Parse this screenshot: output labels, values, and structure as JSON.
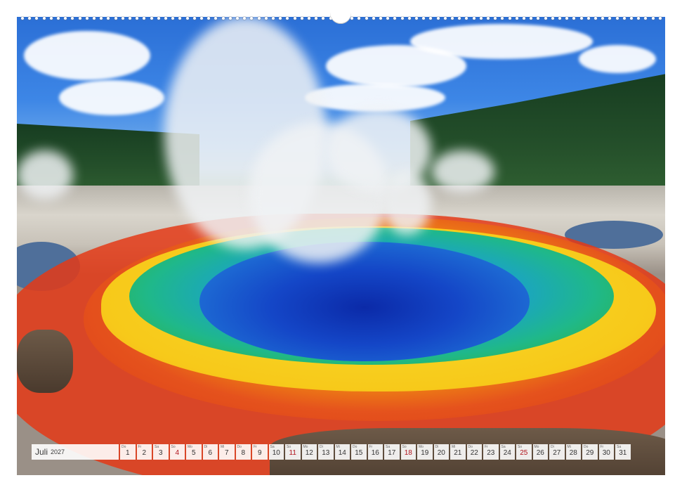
{
  "calendar": {
    "month": "Juli",
    "year": "2027",
    "days": [
      {
        "dow": "Do",
        "num": "1"
      },
      {
        "dow": "Fr",
        "num": "2"
      },
      {
        "dow": "Sa",
        "num": "3"
      },
      {
        "dow": "So",
        "num": "4",
        "sun": true
      },
      {
        "dow": "Mo",
        "num": "5"
      },
      {
        "dow": "Di",
        "num": "6"
      },
      {
        "dow": "Mi",
        "num": "7"
      },
      {
        "dow": "Do",
        "num": "8"
      },
      {
        "dow": "Fr",
        "num": "9"
      },
      {
        "dow": "Sa",
        "num": "10"
      },
      {
        "dow": "So",
        "num": "11",
        "sun": true
      },
      {
        "dow": "Mo",
        "num": "12"
      },
      {
        "dow": "Di",
        "num": "13"
      },
      {
        "dow": "Mi",
        "num": "14"
      },
      {
        "dow": "Do",
        "num": "15"
      },
      {
        "dow": "Fr",
        "num": "16"
      },
      {
        "dow": "Sa",
        "num": "17"
      },
      {
        "dow": "So",
        "num": "18",
        "sun": true
      },
      {
        "dow": "Mo",
        "num": "19"
      },
      {
        "dow": "Di",
        "num": "20"
      },
      {
        "dow": "Mi",
        "num": "21"
      },
      {
        "dow": "Do",
        "num": "22"
      },
      {
        "dow": "Fr",
        "num": "23"
      },
      {
        "dow": "Sa",
        "num": "24"
      },
      {
        "dow": "So",
        "num": "25",
        "sun": true
      },
      {
        "dow": "Mo",
        "num": "26"
      },
      {
        "dow": "Di",
        "num": "27"
      },
      {
        "dow": "Mi",
        "num": "28"
      },
      {
        "dow": "Do",
        "num": "29"
      },
      {
        "dow": "Fr",
        "num": "30"
      },
      {
        "dow": "Sa",
        "num": "31"
      }
    ]
  },
  "colors": {
    "sunday": "#b0121b"
  }
}
